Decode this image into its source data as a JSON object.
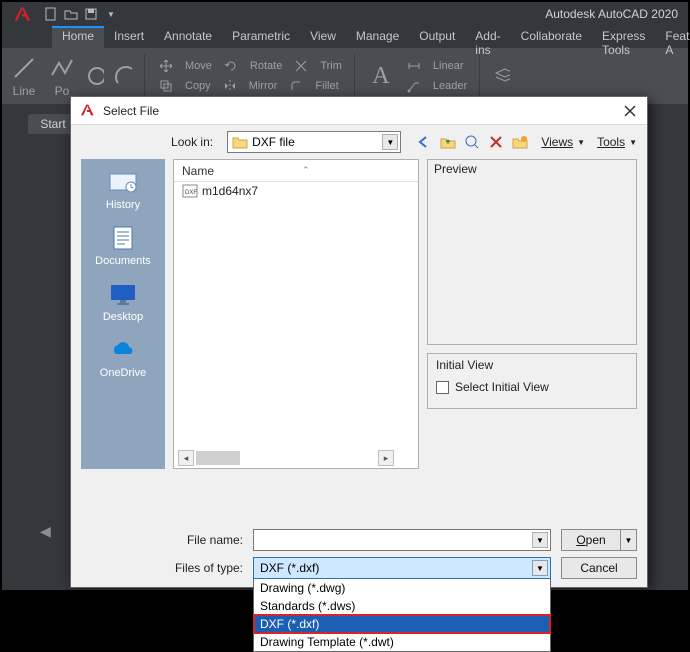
{
  "app": {
    "title": "Autodesk AutoCAD 2020"
  },
  "ribbon_tabs": [
    "Home",
    "Insert",
    "Annotate",
    "Parametric",
    "View",
    "Manage",
    "Output",
    "Add-ins",
    "Collaborate",
    "Express Tools",
    "Featured A"
  ],
  "ribbon": {
    "line": "Line",
    "po": "Po",
    "move": "Move",
    "rotate": "Rotate",
    "trim": "Trim",
    "copy": "Copy",
    "mirror": "Mirror",
    "fillet": "Fillet",
    "linear": "Linear",
    "leader": "Leader"
  },
  "start_tab": "Start",
  "dialog": {
    "title": "Select File",
    "look_in_label": "Look in:",
    "look_in_value": "DXF file",
    "views_label": "Views",
    "tools_label": "Tools",
    "places": {
      "history": "History",
      "documents": "Documents",
      "desktop": "Desktop",
      "onedrive": "OneDrive"
    },
    "filelist": {
      "header_name": "Name",
      "file1": "m1d64nx7"
    },
    "preview_label": "Preview",
    "initial_view_label": "Initial View",
    "select_initial_view": "Select Initial View",
    "file_name_label": "File name:",
    "file_name_value": "",
    "files_of_type_label": "Files of type:",
    "files_of_type_value": "DXF (*.dxf)",
    "type_options": [
      "Drawing (*.dwg)",
      "Standards (*.dws)",
      "DXF (*.dxf)",
      "Drawing Template (*.dwt)"
    ],
    "open_btn": "Open",
    "cancel_btn": "Cancel"
  }
}
